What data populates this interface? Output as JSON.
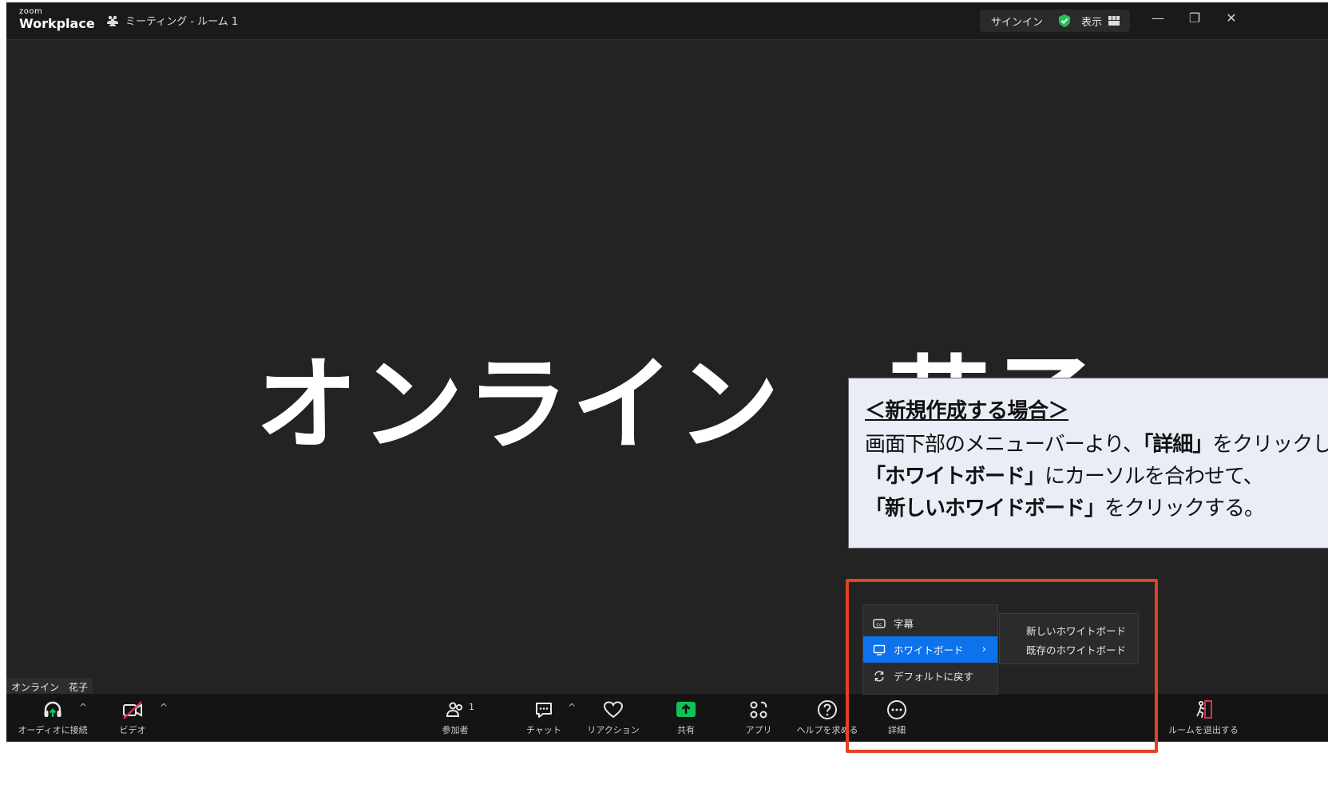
{
  "titlebar": {
    "logo_small": "zoom",
    "logo_big": "Workplace",
    "room_name": "ミーティング - ルーム 1",
    "sign_in": "サインイン",
    "view": "表示"
  },
  "window_controls": {
    "minimize": "—",
    "restore": "❐",
    "close": "✕"
  },
  "main": {
    "display_name": "オンライン　花子",
    "name_tag": "オンライン　花子"
  },
  "callout": {
    "heading": "＜新規作成する場合＞",
    "line1_pre": "画面下部のメニューバーより、",
    "line1_bold": "「詳細」",
    "line1_post": "をクリックし、",
    "line2_bold": "「ホワイトボード」",
    "line2_post": "にカーソルを合わせて、",
    "line3_bold": "「新しいホワイドボード」",
    "line3_post": "をクリックする。"
  },
  "menu": {
    "items": [
      {
        "label": "字幕",
        "icon": "cc-icon"
      },
      {
        "label": "ホワイトボード",
        "icon": "whiteboard-icon",
        "active": true
      },
      {
        "label": "デフォルトに戻す",
        "icon": "reset-icon"
      }
    ],
    "chevron": "›"
  },
  "submenu": {
    "items": [
      {
        "label": "新しいホワイトボード"
      },
      {
        "label": "既存のホワイトボード"
      }
    ]
  },
  "toolbar": {
    "audio": "オーディオに接続",
    "video": "ビデオ",
    "participants": "参加者",
    "participants_count": "1",
    "chat": "チャット",
    "reactions": "リアクション",
    "share": "共有",
    "apps": "アプリ",
    "help": "ヘルプを求める",
    "more": "詳細",
    "leave": "ルームを退出する",
    "caret": "^"
  },
  "colors": {
    "accent_blue": "#0e72ed",
    "share_green": "#13c15b",
    "highlight_red": "#e0431f",
    "leave_red": "#e5294b",
    "shield_green": "#21c05a"
  }
}
